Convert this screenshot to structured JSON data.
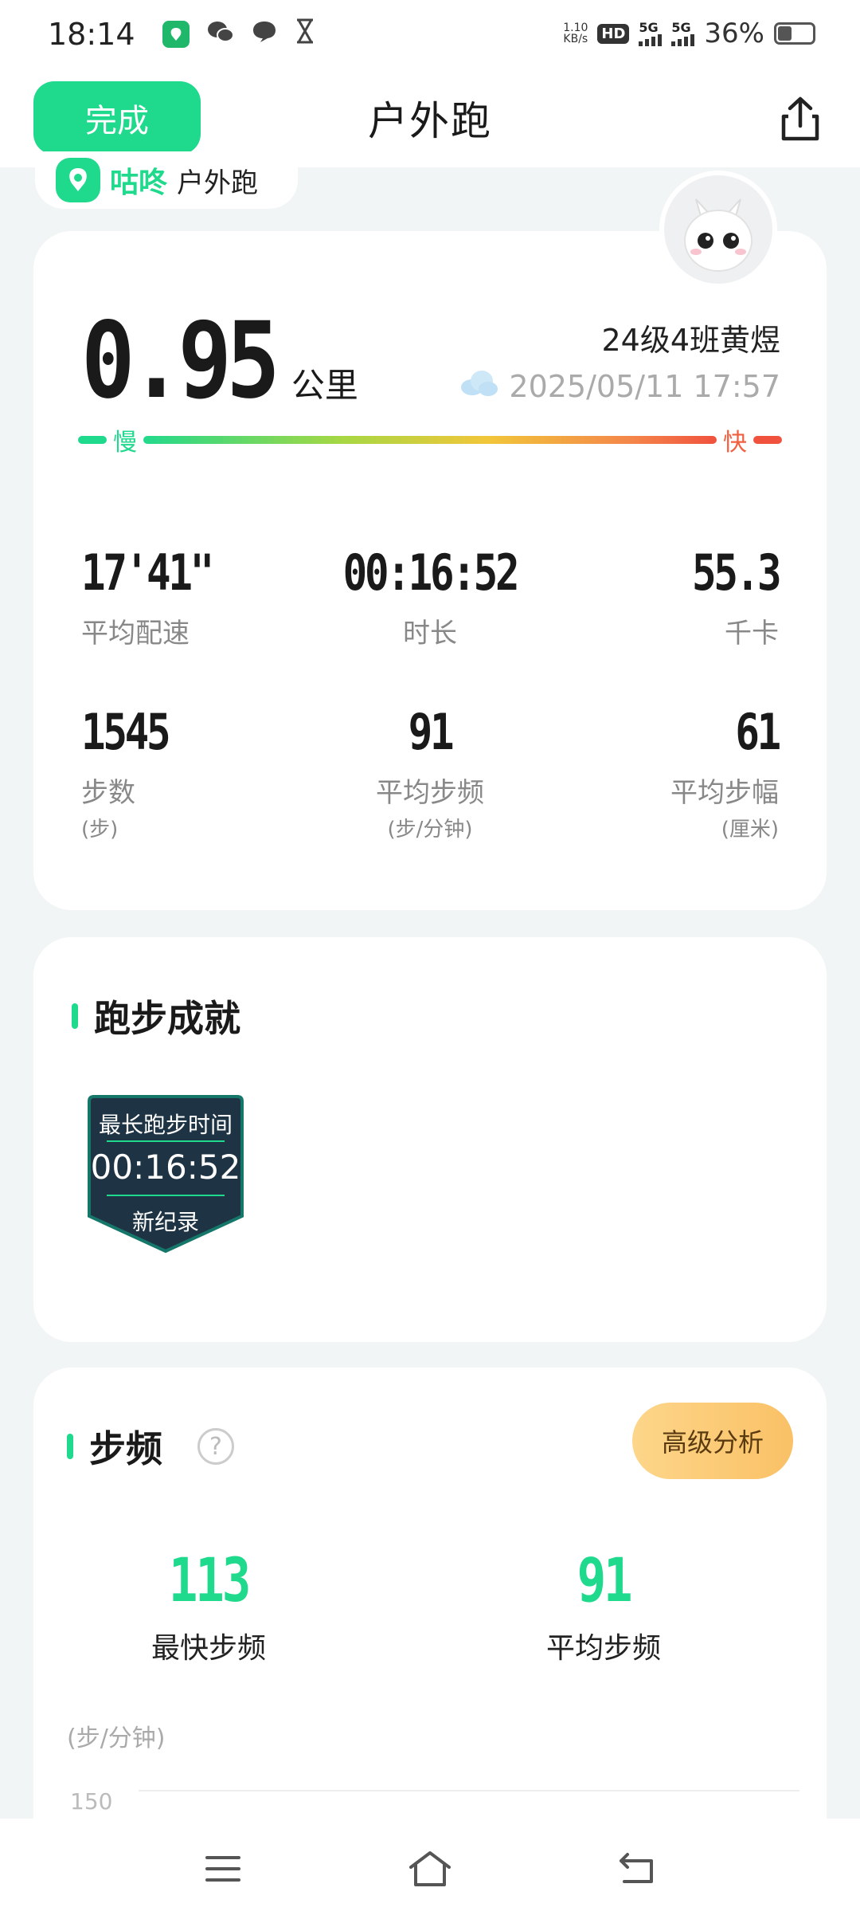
{
  "status_bar": {
    "time": "18:14",
    "net_speed_top": "1.10",
    "net_speed_unit": "KB/s",
    "sim1": "5G",
    "sim2": "5G",
    "battery": "36%"
  },
  "header": {
    "done_label": "完成",
    "title": "户外跑"
  },
  "brand": {
    "name": "咕咚",
    "subtitle": "户外跑"
  },
  "summary": {
    "distance": "0.95",
    "distance_unit": "公里",
    "user": "24级4班黄煜",
    "datetime": "2025/05/11 17:57",
    "pace_slow": "慢",
    "pace_fast": "快"
  },
  "stats": [
    {
      "value": "17'41\"",
      "label": "平均配速",
      "unit": ""
    },
    {
      "value": "00:16:52",
      "label": "时长",
      "unit": ""
    },
    {
      "value": "55.3",
      "label": "千卡",
      "unit": ""
    },
    {
      "value": "1545",
      "label": "步数",
      "unit": "(步)"
    },
    {
      "value": "91",
      "label": "平均步频",
      "unit": "(步/分钟)"
    },
    {
      "value": "61",
      "label": "平均步幅",
      "unit": "(厘米)"
    }
  ],
  "achievements": {
    "title": "跑步成就",
    "badge": {
      "title": "最长跑步时间",
      "value": "00:16:52",
      "tag": "新纪录"
    }
  },
  "cadence": {
    "title": "步频",
    "help": "?",
    "advanced_label": "高级分析",
    "max_value": "113",
    "max_label": "最快步频",
    "avg_value": "91",
    "avg_label": "平均步频",
    "axis_unit": "(步/分钟)",
    "axis_tick": "150"
  },
  "colors": {
    "accent": "#1FD98C",
    "fast": "#F0523E",
    "badge_bg": "#1E3445"
  }
}
